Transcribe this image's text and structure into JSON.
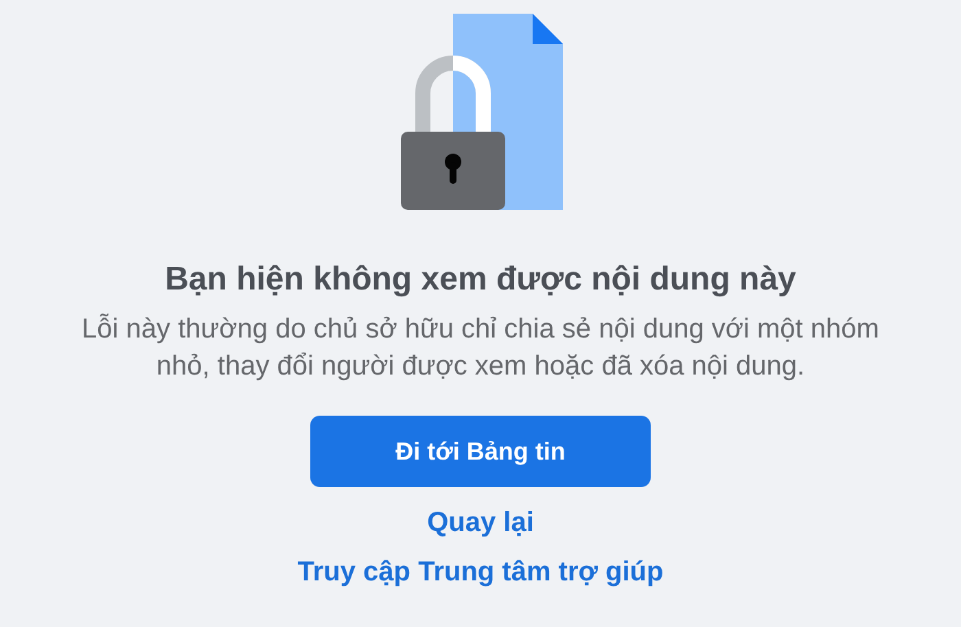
{
  "title": "Bạn hiện không xem được nội dung này",
  "message": "Lỗi này thường do chủ sở hữu chỉ chia sẻ nội dung với một nhóm nhỏ, thay đổi người được xem hoặc đã xóa nội dung.",
  "primary_button": "Đi tới Bảng tin",
  "links": [
    "Quay lại",
    "Truy cập Trung tâm trợ giúp"
  ]
}
